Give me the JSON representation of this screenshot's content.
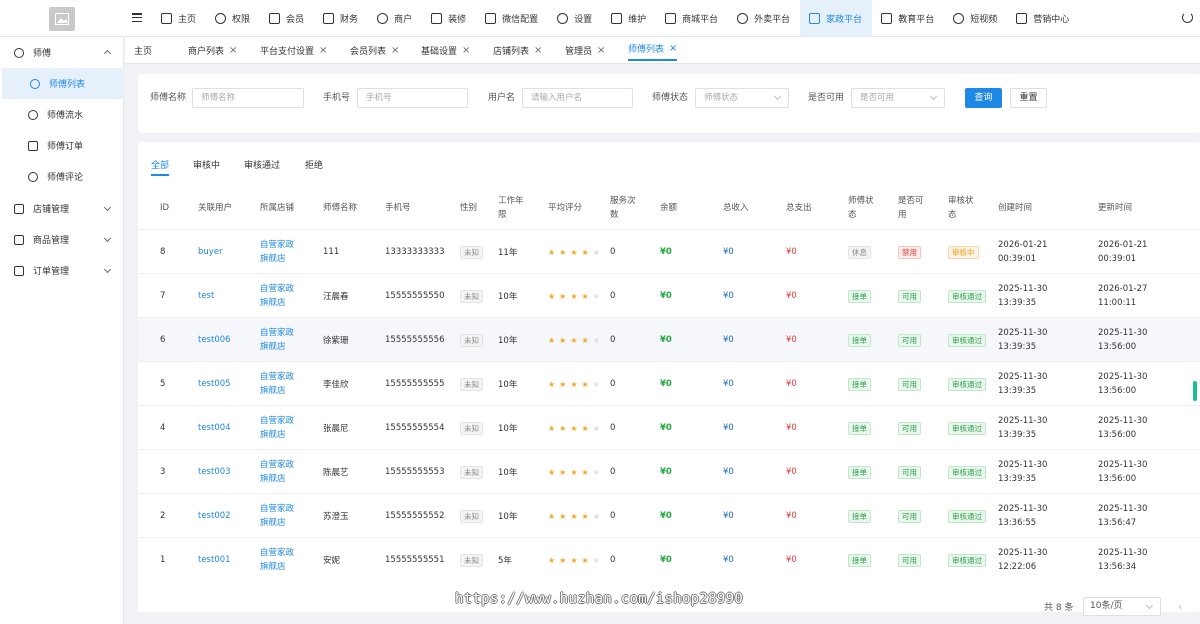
{
  "topnav": {
    "items": [
      {
        "label": "主页",
        "icon": "home-icon"
      },
      {
        "label": "权限",
        "icon": "gear-icon"
      },
      {
        "label": "会员",
        "icon": "user-icon"
      },
      {
        "label": "财务",
        "icon": "finance-icon"
      },
      {
        "label": "商户",
        "icon": "store-icon"
      },
      {
        "label": "装修",
        "icon": "palette-icon"
      },
      {
        "label": "微信配置",
        "icon": "wechat-icon"
      },
      {
        "label": "设置",
        "icon": "gear-icon"
      },
      {
        "label": "维护",
        "icon": "location-icon"
      },
      {
        "label": "商城平台",
        "icon": "shop-icon"
      },
      {
        "label": "外卖平台",
        "icon": "takeout-icon"
      },
      {
        "label": "家政平台",
        "icon": "home-icon",
        "active": true
      },
      {
        "label": "教育平台",
        "icon": "video-icon"
      },
      {
        "label": "短视频",
        "icon": "video-icon"
      },
      {
        "label": "营销中心",
        "icon": "marketing-icon"
      }
    ]
  },
  "sidebar": {
    "group": "师傅",
    "subitems": [
      "师傅列表",
      "师傅流水",
      "师傅订单",
      "师傅评论"
    ],
    "groups": [
      "店铺管理",
      "商品管理",
      "订单管理"
    ]
  },
  "tabs": [
    "主页",
    "商户列表",
    "平台支付设置",
    "会员列表",
    "基础设置",
    "店铺列表",
    "管理员",
    "师傅列表"
  ],
  "filters": {
    "name_label": "师傅名称",
    "name_placeholder": "师傅名称",
    "phone_label": "手机号",
    "phone_placeholder": "手机号",
    "username_label": "用户名",
    "username_placeholder": "请输入用户名",
    "status_label": "师傅状态",
    "status_placeholder": "师傅状态",
    "available_label": "是否可用",
    "available_placeholder": "是否可用",
    "search_button": "查询",
    "reset_button": "重置"
  },
  "status_tabs": [
    "全部",
    "审核中",
    "审核通过",
    "拒绝"
  ],
  "table": {
    "headers": [
      "ID",
      "关联用户",
      "所属店铺",
      "师傅名称",
      "手机号",
      "性别",
      "工作年限",
      "平均评分",
      "服务次数",
      "余额",
      "总收入",
      "总支出",
      "师傅状态",
      "是否可用",
      "审核状态",
      "创建时间",
      "更新时间"
    ],
    "rows": [
      {
        "id": "8",
        "user": "buyer",
        "shop": "自营家政旗舰店",
        "name": "111",
        "phone": "13333333333",
        "gender": "未知",
        "years": "11年",
        "rating": 4,
        "count": "0",
        "balance": "¥0",
        "income": "¥0",
        "expense": "¥0",
        "status": "休息",
        "available": "禁用",
        "audit": "审核中",
        "created": "2026-01-21 00:39:01",
        "updated": "2026-01-21 00:39:01"
      },
      {
        "id": "7",
        "user": "test",
        "shop": "自营家政旗舰店",
        "name": "汪晨春",
        "phone": "15555555550",
        "gender": "未知",
        "years": "10年",
        "rating": 4,
        "count": "0",
        "balance": "¥0",
        "income": "¥0",
        "expense": "¥0",
        "status": "接单",
        "available": "可用",
        "audit": "审核通过",
        "created": "2025-11-30 13:39:35",
        "updated": "2026-01-27 11:00:11"
      },
      {
        "id": "6",
        "user": "test006",
        "shop": "自营家政旗舰店",
        "name": "徐紫珊",
        "phone": "15555555556",
        "gender": "未知",
        "years": "10年",
        "rating": 4,
        "count": "0",
        "balance": "¥0",
        "income": "¥0",
        "expense": "¥0",
        "status": "接单",
        "available": "可用",
        "audit": "审核通过",
        "created": "2025-11-30 13:39:35",
        "updated": "2025-11-30 13:56:00"
      },
      {
        "id": "5",
        "user": "test005",
        "shop": "自营家政旗舰店",
        "name": "李佳欣",
        "phone": "15555555555",
        "gender": "未知",
        "years": "10年",
        "rating": 4,
        "count": "0",
        "balance": "¥0",
        "income": "¥0",
        "expense": "¥0",
        "status": "接单",
        "available": "可用",
        "audit": "审核通过",
        "created": "2025-11-30 13:39:35",
        "updated": "2025-11-30 13:56:00"
      },
      {
        "id": "4",
        "user": "test004",
        "shop": "自营家政旗舰店",
        "name": "张晨尼",
        "phone": "15555555554",
        "gender": "未知",
        "years": "10年",
        "rating": 4,
        "count": "0",
        "balance": "¥0",
        "income": "¥0",
        "expense": "¥0",
        "status": "接单",
        "available": "可用",
        "audit": "审核通过",
        "created": "2025-11-30 13:39:35",
        "updated": "2025-11-30 13:56:00"
      },
      {
        "id": "3",
        "user": "test003",
        "shop": "自营家政旗舰店",
        "name": "陈晨艺",
        "phone": "15555555553",
        "gender": "未知",
        "years": "10年",
        "rating": 4,
        "count": "0",
        "balance": "¥0",
        "income": "¥0",
        "expense": "¥0",
        "status": "接单",
        "available": "可用",
        "audit": "审核通过",
        "created": "2025-11-30 13:39:35",
        "updated": "2025-11-30 13:56:00"
      },
      {
        "id": "2",
        "user": "test002",
        "shop": "自营家政旗舰店",
        "name": "苏澄玉",
        "phone": "15555555552",
        "gender": "未知",
        "years": "10年",
        "rating": 4,
        "count": "0",
        "balance": "¥0",
        "income": "¥0",
        "expense": "¥0",
        "status": "接单",
        "available": "可用",
        "audit": "审核通过",
        "created": "2025-11-30 13:36:55",
        "updated": "2025-11-30 13:56:47"
      },
      {
        "id": "1",
        "user": "test001",
        "shop": "自营家政旗舰店",
        "name": "安妮",
        "phone": "15555555551",
        "gender": "未知",
        "years": "5年",
        "rating": 4,
        "count": "0",
        "balance": "¥0",
        "income": "¥0",
        "expense": "¥0",
        "status": "接单",
        "available": "可用",
        "audit": "审核通过",
        "created": "2025-11-30 12:22:06",
        "updated": "2025-11-30 13:56:34"
      }
    ]
  },
  "pager": {
    "total": "共 8 条",
    "size": "10条/页"
  },
  "watermark": "https://www.huzhan.com/ishop28990"
}
